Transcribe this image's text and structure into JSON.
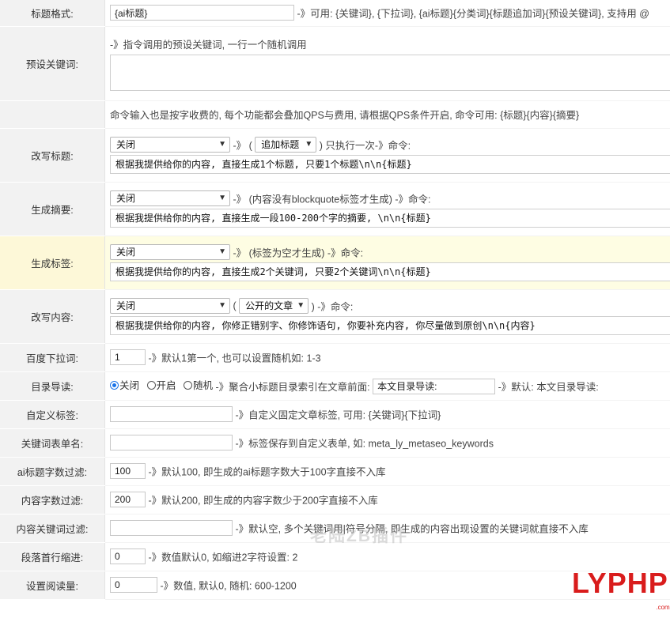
{
  "title_format": {
    "label": "标题格式:",
    "value": "{ai标题}",
    "hint": "-》可用: {关键词}, {下拉词}, {ai标题}{分类词}{标题追加词}{预设关键词}, 支持用 @"
  },
  "preset_keywords": {
    "label": "预设关键词:",
    "hint": "-》指令调用的预设关键词, 一行一个随机调用",
    "value": ""
  },
  "command_note": "命令输入也是按字收费的, 每个功能都会叠加QPS与费用, 请根据QPS条件开启, 命令可用: {标题}{内容}{摘要}",
  "rewrite_title": {
    "label": "改写标题:",
    "select": "关闭",
    "paren_open": "-》 (",
    "sub_select": "追加标题",
    "hint": ") 只执行一次-》命令:",
    "command": "根据我提供给你的内容, 直接生成1个标题, 只要1个标题\\n\\n{标题}"
  },
  "summary": {
    "label": "生成摘要:",
    "select": "关闭",
    "hint": "-》 (内容没有blockquote标签才生成) -》命令:",
    "command": "根据我提供给你的内容, 直接生成一段100-200个字的摘要, \\n\\n{标题}"
  },
  "tags": {
    "label": "生成标签:",
    "select": "关闭",
    "hint": "-》 (标签为空才生成) -》命令:",
    "command": "根据我提供给你的内容, 直接生成2个关键词, 只要2个关键词\\n\\n{标题}"
  },
  "rewrite_content": {
    "label": "改写内容:",
    "select": "关闭",
    "paren_open": "(",
    "sub_select": "公开的文章",
    "hint": ") -》命令:",
    "command": "根据我提供给你的内容, 你修正错别字、你修饰语句, 你要补充内容, 你尽量做到原创\\n\\n{内容}"
  },
  "baidu_dropdown": {
    "label": "百度下拉词:",
    "value": "1",
    "hint": "-》默认1第一个, 也可以设置随机如: 1-3"
  },
  "toc": {
    "label": "目录导读:",
    "options": [
      "关闭",
      "开启",
      "随机"
    ],
    "selected": "关闭",
    "hint": "-》聚合小标题目录索引在文章前面:",
    "value": "本文目录导读:",
    "hint2": "-》默认: 本文目录导读:"
  },
  "custom_tags": {
    "label": "自定义标签:",
    "value": "",
    "hint": "-》自定义固定文章标签, 可用: {关键词}{下拉词}"
  },
  "keyword_form": {
    "label": "关键词表单名:",
    "value": "",
    "hint": "-》标签保存到自定义表单, 如: meta_ly_metaseo_keywords"
  },
  "ai_title_filter": {
    "label": "ai标题字数过滤:",
    "value": "100",
    "hint": "-》默认100, 即生成的ai标题字数大于100字直接不入库"
  },
  "content_filter": {
    "label": "内容字数过滤:",
    "value": "200",
    "hint": "-》默认200, 即生成的内容字数少于200字直接不入库"
  },
  "content_keyword_filter": {
    "label": "内容关键词过滤:",
    "value": "",
    "hint": "-》默认空, 多个关键词用|符号分隔, 即生成的内容出现设置的关键词就直接不入库"
  },
  "indent": {
    "label": "段落首行缩进:",
    "value": "0",
    "hint": "-》数值默认0, 如缩进2字符设置: 2"
  },
  "read_count": {
    "label": "设置阅读量:",
    "value": "0",
    "hint": "-》数值, 默认0, 随机: 600-1200"
  },
  "watermark": "老陆ZB插件",
  "logo": {
    "text": "LYPHP",
    "sub": ".com"
  }
}
